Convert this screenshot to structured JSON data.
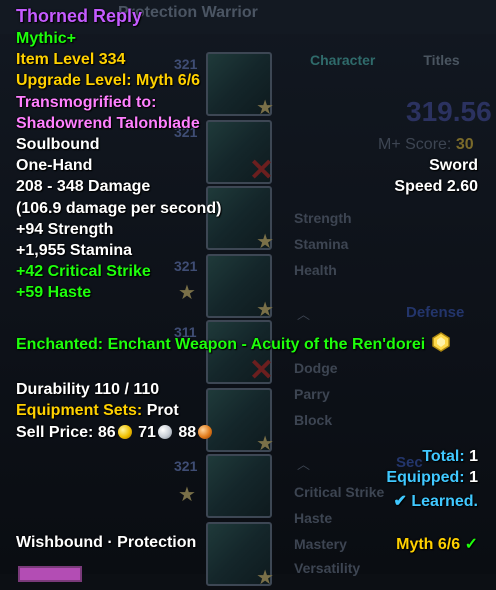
{
  "colors": {
    "item_name": "#c45bff",
    "green": "#1eff0c",
    "yellow": "#ffd100",
    "pink": "#ff80ff",
    "white": "#ffffff",
    "cyan": "#40c8ff"
  },
  "background": {
    "title_partial": "Protection Warrior",
    "tabs": [
      "Character",
      "Titles"
    ],
    "slot_item_levels": [
      "321",
      "321",
      "321",
      "321",
      "311",
      "321",
      "321",
      "321"
    ],
    "score_big": "319.56",
    "mplus_label": "M+ Score:",
    "mplus_value": "30",
    "stats": [
      "Strength",
      "Stamina",
      "Health"
    ],
    "defense_header": "Defense",
    "defense_stats": [
      "Dodge",
      "Parry",
      "Block"
    ],
    "secondary_header": "Sec",
    "secondary_stats": [
      "Critical Strike",
      "Haste",
      "Mastery",
      "Versatility"
    ]
  },
  "tooltip": {
    "name": "Thorned Reply",
    "difficulty": "Mythic+",
    "item_level": "Item Level 334",
    "upgrade_level": "Upgrade Level: Myth 6/6",
    "transmog_label": "Transmogrified to:",
    "transmog_item": "Shadowrend Talonblade",
    "binding": "Soulbound",
    "slot": "One-Hand",
    "type": "Sword",
    "damage": "208 - 348 Damage",
    "speed": "Speed 2.60",
    "dps": "(106.9 damage per second)",
    "primary_stats": [
      "+94 Strength",
      "+1,955 Stamina"
    ],
    "secondary_stats": [
      "+42 Critical Strike",
      "+59 Haste"
    ],
    "enchant": "Enchanted: Enchant Weapon - Acuity of the Ren'dorei",
    "durability": "Durability 110 / 110",
    "equipment_sets_label": "Equipment Sets:",
    "equipment_sets_value": "Prot",
    "sell_price_label": "Sell Price:",
    "sell_gold": "86",
    "sell_silver": "71",
    "sell_copper": "88",
    "total_label": "Total:",
    "total_value": "1",
    "equipped_label": "Equipped:",
    "equipped_value": "1",
    "learned": "Learned.",
    "footer_left": "Wishbound · Protection",
    "footer_right": "Myth 6/6"
  }
}
